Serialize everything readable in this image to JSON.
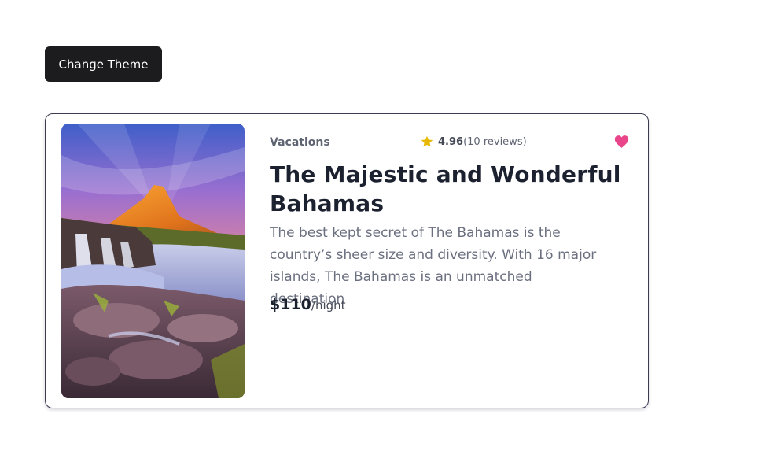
{
  "toolbar": {
    "change_theme_label": "Change Theme"
  },
  "card": {
    "category": "Vacations",
    "rating": {
      "score": "4.96",
      "reviews": "(10 reviews)"
    },
    "favorited": true,
    "title": "The Majestic and Wonderful Bahamas",
    "description": "The best kept secret of The Bahamas is the country’s sheer size and diversity. With 16 major islands, The Bahamas is an unmatched destination",
    "price": {
      "amount": "$110",
      "unit": "/night"
    },
    "icons": {
      "rating": "star-icon",
      "favorite": "heart-icon"
    }
  },
  "colors": {
    "star": "#e6b800",
    "heart": "#e8458b",
    "button": "#1c1c1e"
  }
}
